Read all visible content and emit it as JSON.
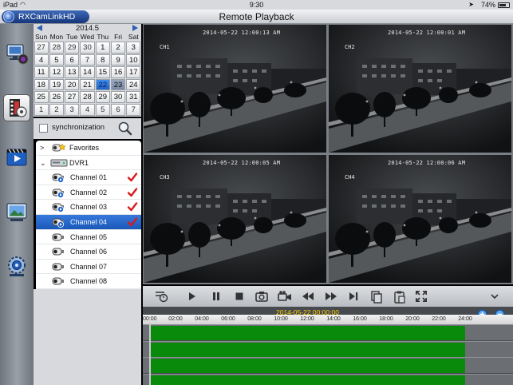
{
  "status_bar": {
    "device": "iPad",
    "time": "9:30",
    "battery": "74%",
    "battery_level": 0.74
  },
  "header": {
    "app_name": "RXCamLinkHD",
    "title": "Remote Playback"
  },
  "sidebar": {
    "tools": [
      {
        "name": "live-view-tool-icon"
      },
      {
        "name": "remote-playback-tool-icon",
        "selected": true
      },
      {
        "name": "local-video-tool-icon"
      },
      {
        "name": "image-tool-icon"
      },
      {
        "name": "settings-tool-icon"
      }
    ]
  },
  "calendar": {
    "month_label": "2014.5",
    "weekdays": [
      "Sun",
      "Mon",
      "Tue",
      "Wed",
      "Thu",
      "Fri",
      "Sat"
    ],
    "days": [
      "27",
      "28",
      "29",
      "30",
      "1",
      "2",
      "3",
      "4",
      "5",
      "6",
      "7",
      "8",
      "9",
      "10",
      "11",
      "12",
      "13",
      "14",
      "15",
      "16",
      "17",
      "18",
      "19",
      "20",
      "21",
      "22",
      "23",
      "24",
      "25",
      "26",
      "27",
      "28",
      "29",
      "30",
      "31",
      "1",
      "2",
      "3",
      "4",
      "5",
      "6",
      "7"
    ],
    "marked_day_index": 25,
    "today_index": 26,
    "other_month": [
      0,
      1,
      2,
      3,
      35,
      36,
      37,
      38,
      39,
      40,
      41
    ]
  },
  "sync": {
    "label": "synchronization",
    "checked": false
  },
  "device_tree": {
    "favorites_label": "Favorites",
    "dvr_label": "DVR1",
    "channels": [
      {
        "label": "Channel 01",
        "checked": true,
        "selected": false,
        "playing": true
      },
      {
        "label": "Channel 02",
        "checked": true,
        "selected": false,
        "playing": true
      },
      {
        "label": "Channel 03",
        "checked": true,
        "selected": false,
        "playing": true
      },
      {
        "label": "Channel 04",
        "checked": true,
        "selected": true,
        "playing": true
      },
      {
        "label": "Channel 05",
        "checked": false,
        "selected": false,
        "playing": false
      },
      {
        "label": "Channel 06",
        "checked": false,
        "selected": false,
        "playing": false
      },
      {
        "label": "Channel 07",
        "checked": false,
        "selected": false,
        "playing": false
      },
      {
        "label": "Channel 08",
        "checked": false,
        "selected": false,
        "playing": false
      }
    ]
  },
  "video_tiles": [
    {
      "timestamp": "2014-05-22 12:00:13 AM",
      "channel": "CH1"
    },
    {
      "timestamp": "2014-05-22 12:00:01 AM",
      "channel": "CH2"
    },
    {
      "timestamp": "2014-05-22 12:00:05 AM",
      "channel": "CH3"
    },
    {
      "timestamp": "2014-05-22 12:00:06 AM",
      "channel": "CH4"
    }
  ],
  "playback_controls": [
    "playback-speed-icon",
    "play-icon",
    "pause-icon",
    "stop-icon",
    "snapshot-icon",
    "record-icon",
    "rewind-icon",
    "fast-forward-icon",
    "step-frame-icon",
    "copy-icon",
    "paste-icon",
    "fullscreen-icon",
    "collapse-chevron-icon"
  ],
  "timeline": {
    "current_time": "2014-05-22 00:00:00",
    "hour_labels": [
      "00:00",
      "02:00",
      "04:00",
      "06:00",
      "08:00",
      "10:00",
      "12:00",
      "14:00",
      "16:00",
      "18:00",
      "20:00",
      "22:00",
      "24:00"
    ],
    "recording_range_hours": [
      0,
      24
    ],
    "track_count": 4,
    "record_color": "#0a8a0a"
  },
  "colors": {
    "accent": "#1b58b8",
    "check": "#d81b1b",
    "record": "#0a8a0a",
    "timeline_date": "#ffd200"
  }
}
